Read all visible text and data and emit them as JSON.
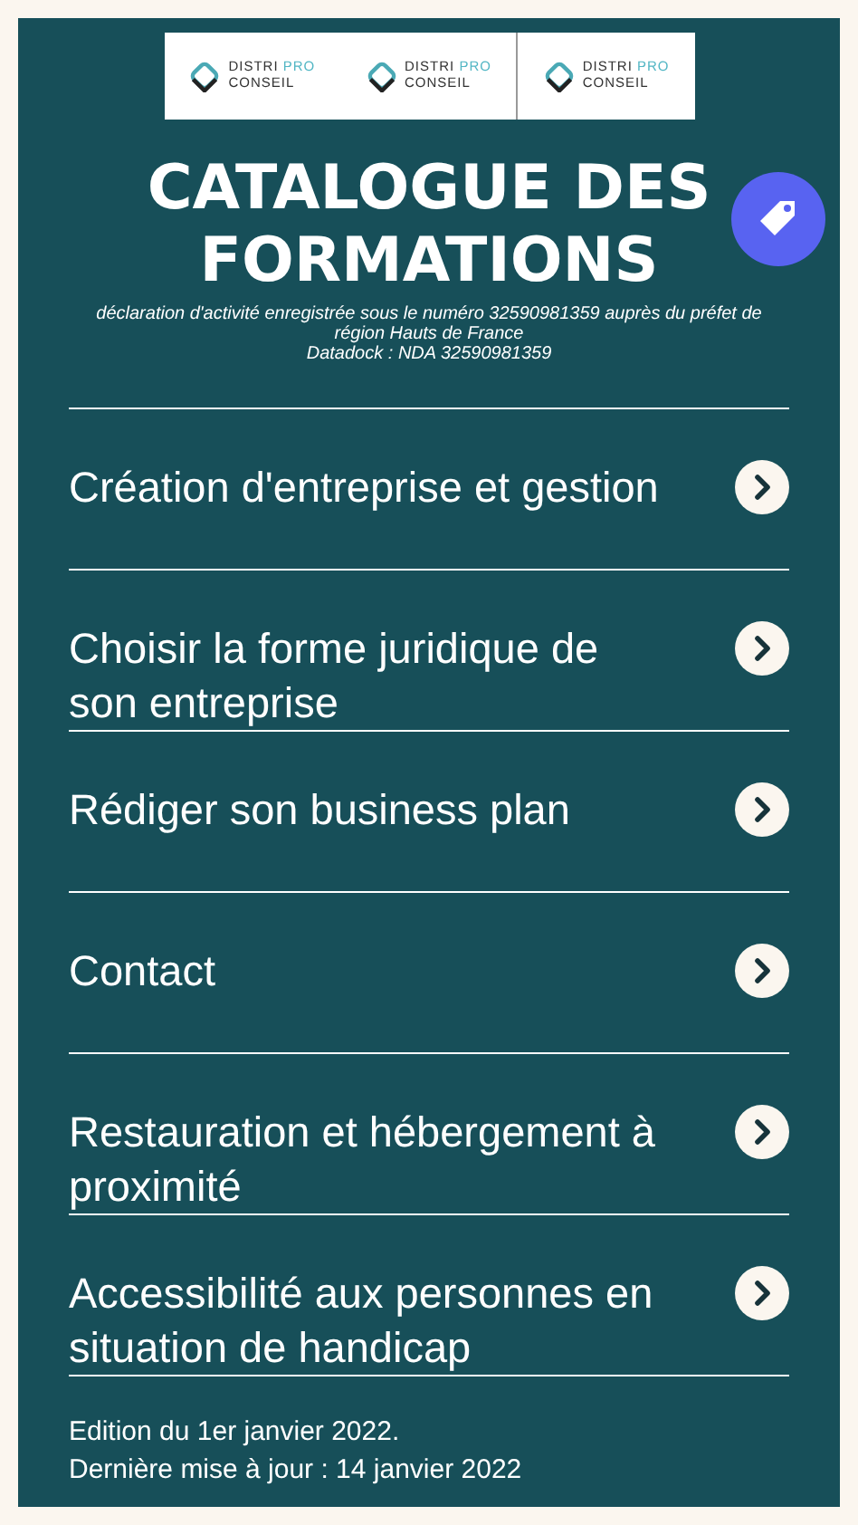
{
  "logos": [
    {
      "line_1": "DISTRI",
      "line_1_accent": "PRO",
      "line_2": "CONSEIL"
    },
    {
      "line_1": "DISTRI",
      "line_1_accent": "PRO",
      "line_2": "CONSEIL"
    },
    {
      "line_1": "DISTRI",
      "line_1_accent": "PRO",
      "line_2": "CONSEIL"
    }
  ],
  "title": "CATALOGUE DES FORMATIONS",
  "declaration": [
    "déclaration d'activité enregistrée sous le numéro 32590981359 auprès du préfet de région Hauts de France",
    "Datadock : NDA 32590981359"
  ],
  "menu": [
    {
      "label": "Création d'entreprise et gestion"
    },
    {
      "label": "Choisir la forme juridique de son entreprise"
    },
    {
      "label": "Rédiger son business plan"
    },
    {
      "label": "Contact"
    },
    {
      "label": "Restauration et hébergement à proximité"
    },
    {
      "label": "Accessibilité aux personnes en situation de handicap"
    }
  ],
  "footer": [
    "Edition du 1er janvier 2022.",
    "Dernière mise à jour : 14 janvier 2022"
  ]
}
